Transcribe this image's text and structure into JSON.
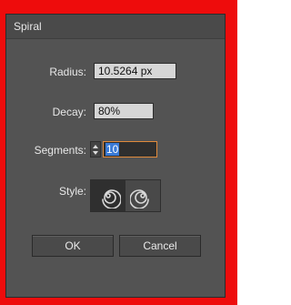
{
  "dialog": {
    "title": "Spiral",
    "radius": {
      "label": "Radius:",
      "value": "10.5264 px"
    },
    "decay": {
      "label": "Decay:",
      "value": "80%"
    },
    "segments": {
      "label": "Segments:",
      "value": "10"
    },
    "style": {
      "label": "Style:",
      "options": [
        {
          "icon": "spiral-counterclockwise-icon",
          "selected": true
        },
        {
          "icon": "spiral-clockwise-icon",
          "selected": false
        }
      ]
    },
    "ok_label": "OK",
    "cancel_label": "Cancel"
  },
  "colors": {
    "frame": "#ee0c0c",
    "dialog_bg": "#535353",
    "focus_border": "#e08a3c",
    "selection": "#3a7ad6"
  }
}
